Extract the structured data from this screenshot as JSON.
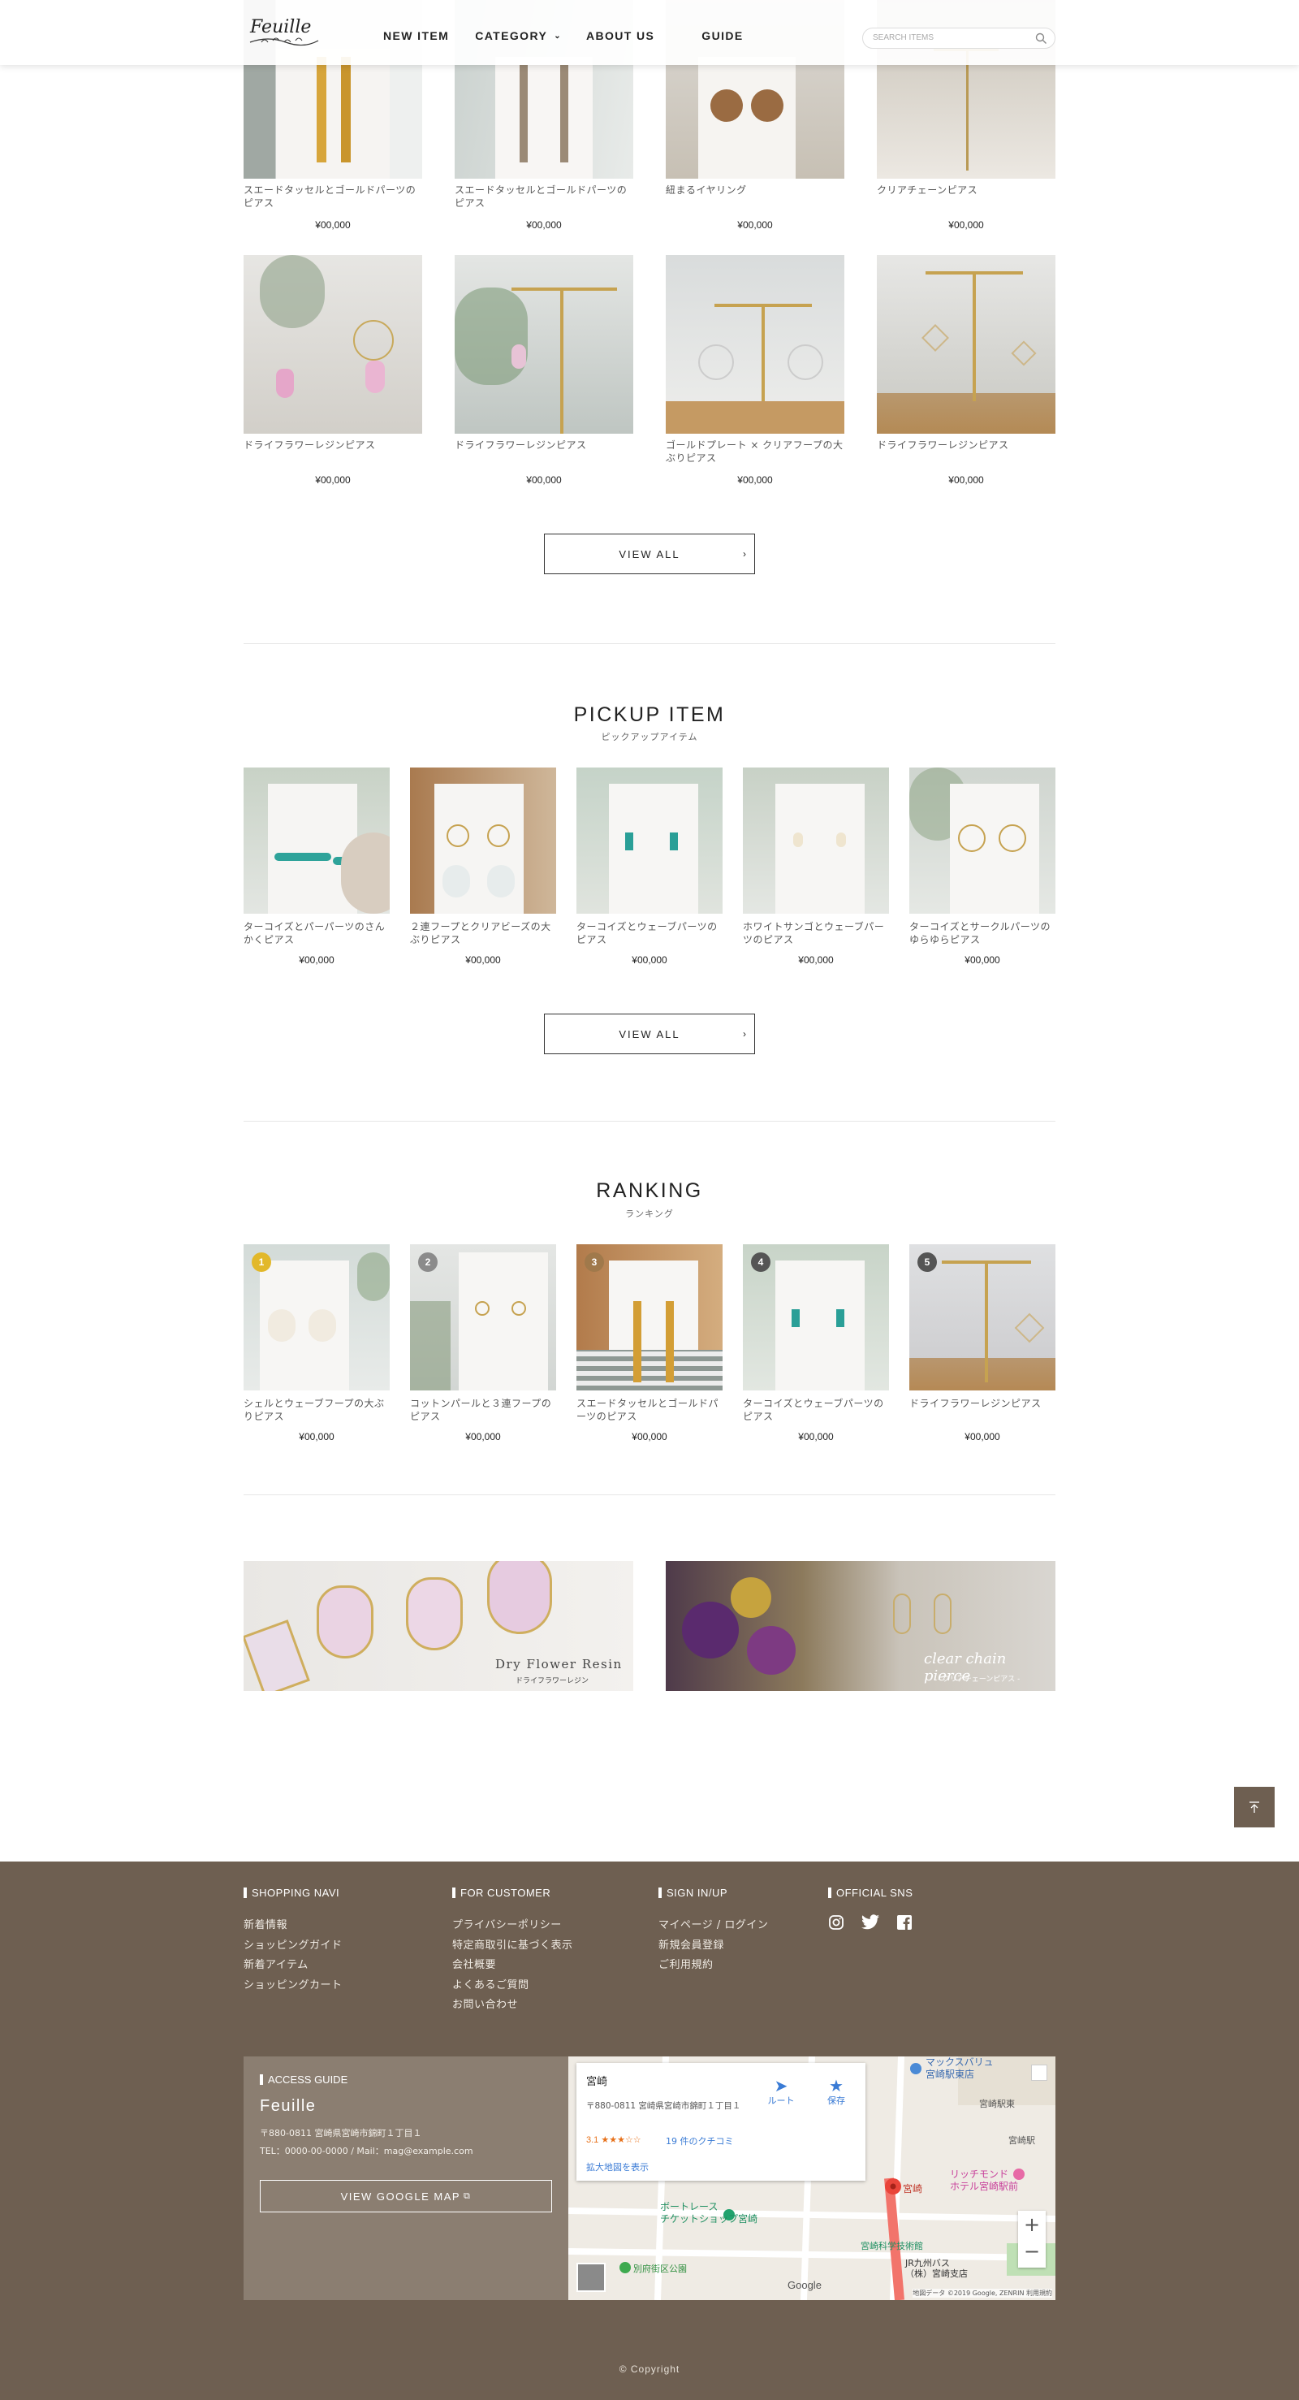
{
  "header": {
    "logo_text": "Feuille",
    "nav": {
      "new_item": "NEW ITEM",
      "category": "CATEGORY",
      "about": "ABOUT US",
      "guide": "GUIDE"
    },
    "search_placeholder": "SEARCH ITEMS"
  },
  "new_items": {
    "row1": [
      {
        "title": "スエードタッセルとゴールドパーツのピアス",
        "price": "¥00,000"
      },
      {
        "title": "スエードタッセルとゴールドパーツのピアス",
        "price": "¥00,000"
      },
      {
        "title": "紐まるイヤリング",
        "price": "¥00,000"
      },
      {
        "title": "クリアチェーンピアス",
        "price": "¥00,000"
      }
    ],
    "row2": [
      {
        "title": "ドライフラワーレジンピアス",
        "price": "¥00,000"
      },
      {
        "title": "ドライフラワーレジンピアス",
        "price": "¥00,000"
      },
      {
        "title": "ゴールドプレート × クリアフープの大ぶりピアス",
        "price": "¥00,000"
      },
      {
        "title": "ドライフラワーレジンピアス",
        "price": "¥00,000"
      }
    ],
    "view_all": "VIEW ALL"
  },
  "pickup": {
    "title": "PICKUP ITEM",
    "subtitle": "ピックアップアイテム",
    "items": [
      {
        "title": "ターコイズとパーパーツのさんかくピアス",
        "price": "¥00,000"
      },
      {
        "title": "２連フープとクリアビーズの大ぶりピアス",
        "price": "¥00,000"
      },
      {
        "title": "ターコイズとウェーブパーツのピアス",
        "price": "¥00,000"
      },
      {
        "title": "ホワイトサンゴとウェーブパーツのピアス",
        "price": "¥00,000"
      },
      {
        "title": "ターコイズとサークルパーツのゆらゆらピアス",
        "price": "¥00,000"
      }
    ],
    "view_all": "VIEW ALL"
  },
  "ranking": {
    "title": "RANKING",
    "subtitle": "ランキング",
    "items": [
      {
        "rank": "1",
        "title": "シェルとウェーブフープの大ぶりピアス",
        "price": "¥00,000"
      },
      {
        "rank": "2",
        "title": "コットンパールと３連フープのピアス",
        "price": "¥00,000"
      },
      {
        "rank": "3",
        "title": "スエードタッセルとゴールドパーツのピアス",
        "price": "¥00,000"
      },
      {
        "rank": "4",
        "title": "ターコイズとウェーブパーツのピアス",
        "price": "¥00,000"
      },
      {
        "rank": "5",
        "title": "ドライフラワーレジンピアス",
        "price": "¥00,000"
      }
    ],
    "rank_colors": [
      "#e2b82a",
      "#8b8b8b",
      "#a0794b",
      "#555555",
      "#555555"
    ]
  },
  "banners": {
    "left": {
      "title": "Dry Flower Resin",
      "sub": "ドライフラワーレジン"
    },
    "right": {
      "title": "clear chain pierce",
      "sub": "- クリアチェーンピアス -"
    }
  },
  "footer": {
    "shopping_navi": {
      "head": "SHOPPING NAVI",
      "links": [
        "新着情報",
        "ショッピングガイド",
        "新着アイテム",
        "ショッピングカート"
      ]
    },
    "for_customer": {
      "head": "FOR CUSTOMER",
      "links": [
        "プライバシーポリシー",
        "特定商取引に基づく表示",
        "会社概要",
        "よくあるご質問",
        "お問い合わせ"
      ]
    },
    "sign_in": {
      "head": "SIGN IN/UP",
      "links": [
        "マイページ / ログイン",
        "新規会員登録",
        "ご利用規約"
      ]
    },
    "sns": {
      "head": "OFFICIAL SNS",
      "icons": [
        "instagram-icon",
        "twitter-icon",
        "facebook-icon"
      ]
    },
    "access": {
      "head": "ACCESS GUIDE",
      "name": "Feuille",
      "address": "〒880-0811 宮崎県宮崎市錦町１丁目１",
      "contact": "TEL：0000-00-0000 / Mail：mag@example.com",
      "map_button": "VIEW GOOGLE MAP"
    },
    "map": {
      "place": "宮崎",
      "address": "〒880-0811 宮崎県宮崎市錦町１丁目１",
      "rating": "3.1",
      "stars": "★★★☆☆",
      "reviews": "19 件のクチコミ",
      "enlarge": "拡大地図を表示",
      "route": "ルート",
      "save": "保存",
      "labels": {
        "maxvalu": "マックスバリュ\n宮崎駅東店",
        "station_east": "宮崎駅東",
        "station": "宮崎駅",
        "richmond": "リッチモンド\nホテル宮崎駅前",
        "boat": "ボートレース\nチケットショップ宮崎",
        "science": "宮崎科学技術館",
        "jr_bus": "JR九州バス\n（株）宮崎支店",
        "park": "別府街区公園",
        "miyazaki": "宮崎",
        "google": "Google",
        "attribution": "地図データ ©2019 Google, ZENRIN 利用規約"
      }
    },
    "copyright": "© Copyright"
  }
}
